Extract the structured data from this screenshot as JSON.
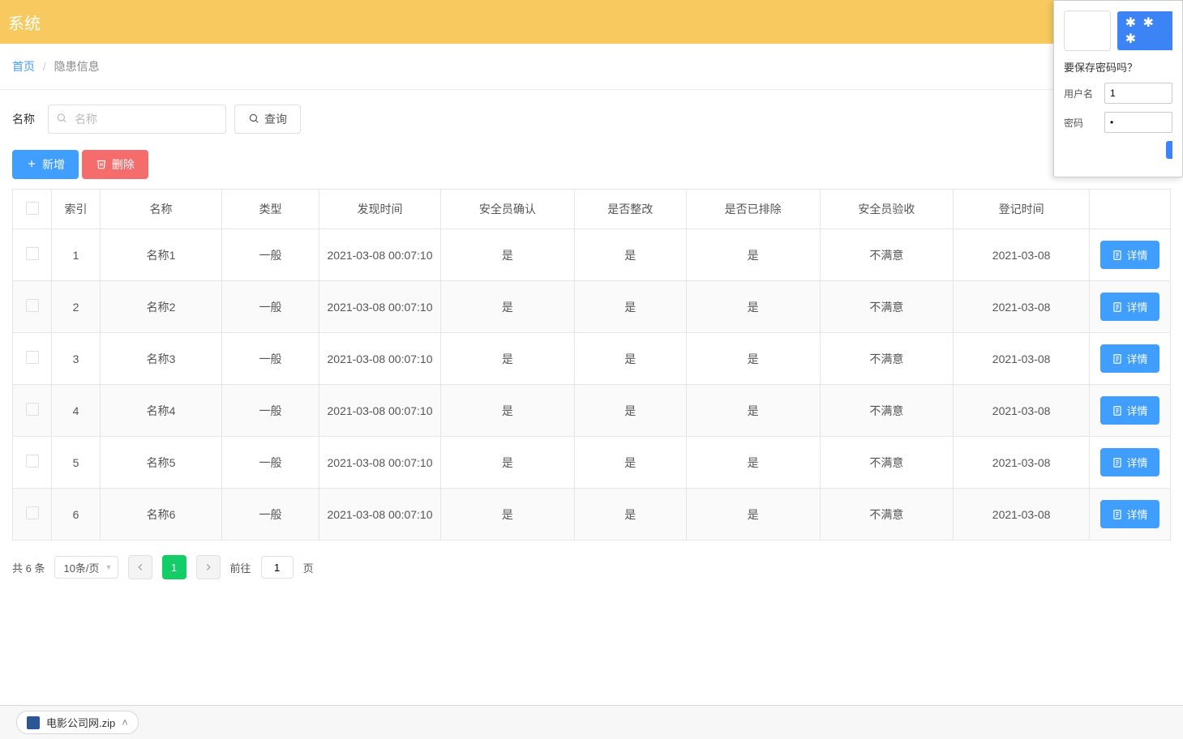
{
  "header": {
    "title": "系统"
  },
  "breadcrumb": {
    "home": "首页",
    "current": "隐患信息"
  },
  "filter": {
    "name_label": "名称",
    "name_placeholder": "名称",
    "search_label": "查询"
  },
  "actions": {
    "add": "新增",
    "delete": "删除"
  },
  "table": {
    "headers": {
      "index": "索引",
      "name": "名称",
      "type": "类型",
      "found_time": "发现时间",
      "safety_confirm": "安全员确认",
      "rectified": "是否整改",
      "excluded": "是否已排除",
      "safety_accept": "安全员验收",
      "register_time": "登记时间"
    },
    "detail_label": "详情",
    "rows": [
      {
        "index": "1",
        "name": "名称1",
        "type": "一般",
        "found_time": "2021-03-08 00:07:10",
        "safety_confirm": "是",
        "rectified": "是",
        "excluded": "是",
        "safety_accept": "不满意",
        "register_time": "2021-03-08"
      },
      {
        "index": "2",
        "name": "名称2",
        "type": "一般",
        "found_time": "2021-03-08 00:07:10",
        "safety_confirm": "是",
        "rectified": "是",
        "excluded": "是",
        "safety_accept": "不满意",
        "register_time": "2021-03-08"
      },
      {
        "index": "3",
        "name": "名称3",
        "type": "一般",
        "found_time": "2021-03-08 00:07:10",
        "safety_confirm": "是",
        "rectified": "是",
        "excluded": "是",
        "safety_accept": "不满意",
        "register_time": "2021-03-08"
      },
      {
        "index": "4",
        "name": "名称4",
        "type": "一般",
        "found_time": "2021-03-08 00:07:10",
        "safety_confirm": "是",
        "rectified": "是",
        "excluded": "是",
        "safety_accept": "不满意",
        "register_time": "2021-03-08"
      },
      {
        "index": "5",
        "name": "名称5",
        "type": "一般",
        "found_time": "2021-03-08 00:07:10",
        "safety_confirm": "是",
        "rectified": "是",
        "excluded": "是",
        "safety_accept": "不满意",
        "register_time": "2021-03-08"
      },
      {
        "index": "6",
        "name": "名称6",
        "type": "一般",
        "found_time": "2021-03-08 00:07:10",
        "safety_confirm": "是",
        "rectified": "是",
        "excluded": "是",
        "safety_accept": "不满意",
        "register_time": "2021-03-08"
      }
    ]
  },
  "pagination": {
    "total_text": "共 6 条",
    "page_size": "10条/页",
    "current": "1",
    "jump_prefix": "前往",
    "jump_value": "1",
    "jump_suffix": "页"
  },
  "save_popup": {
    "asterisk": "✱ ✱ ✱",
    "title": "要保存密码吗？",
    "username_label": "用户名",
    "username_value": "1",
    "password_label": "密码",
    "password_value": "•"
  },
  "download": {
    "filename": "电影公司网.zip"
  }
}
